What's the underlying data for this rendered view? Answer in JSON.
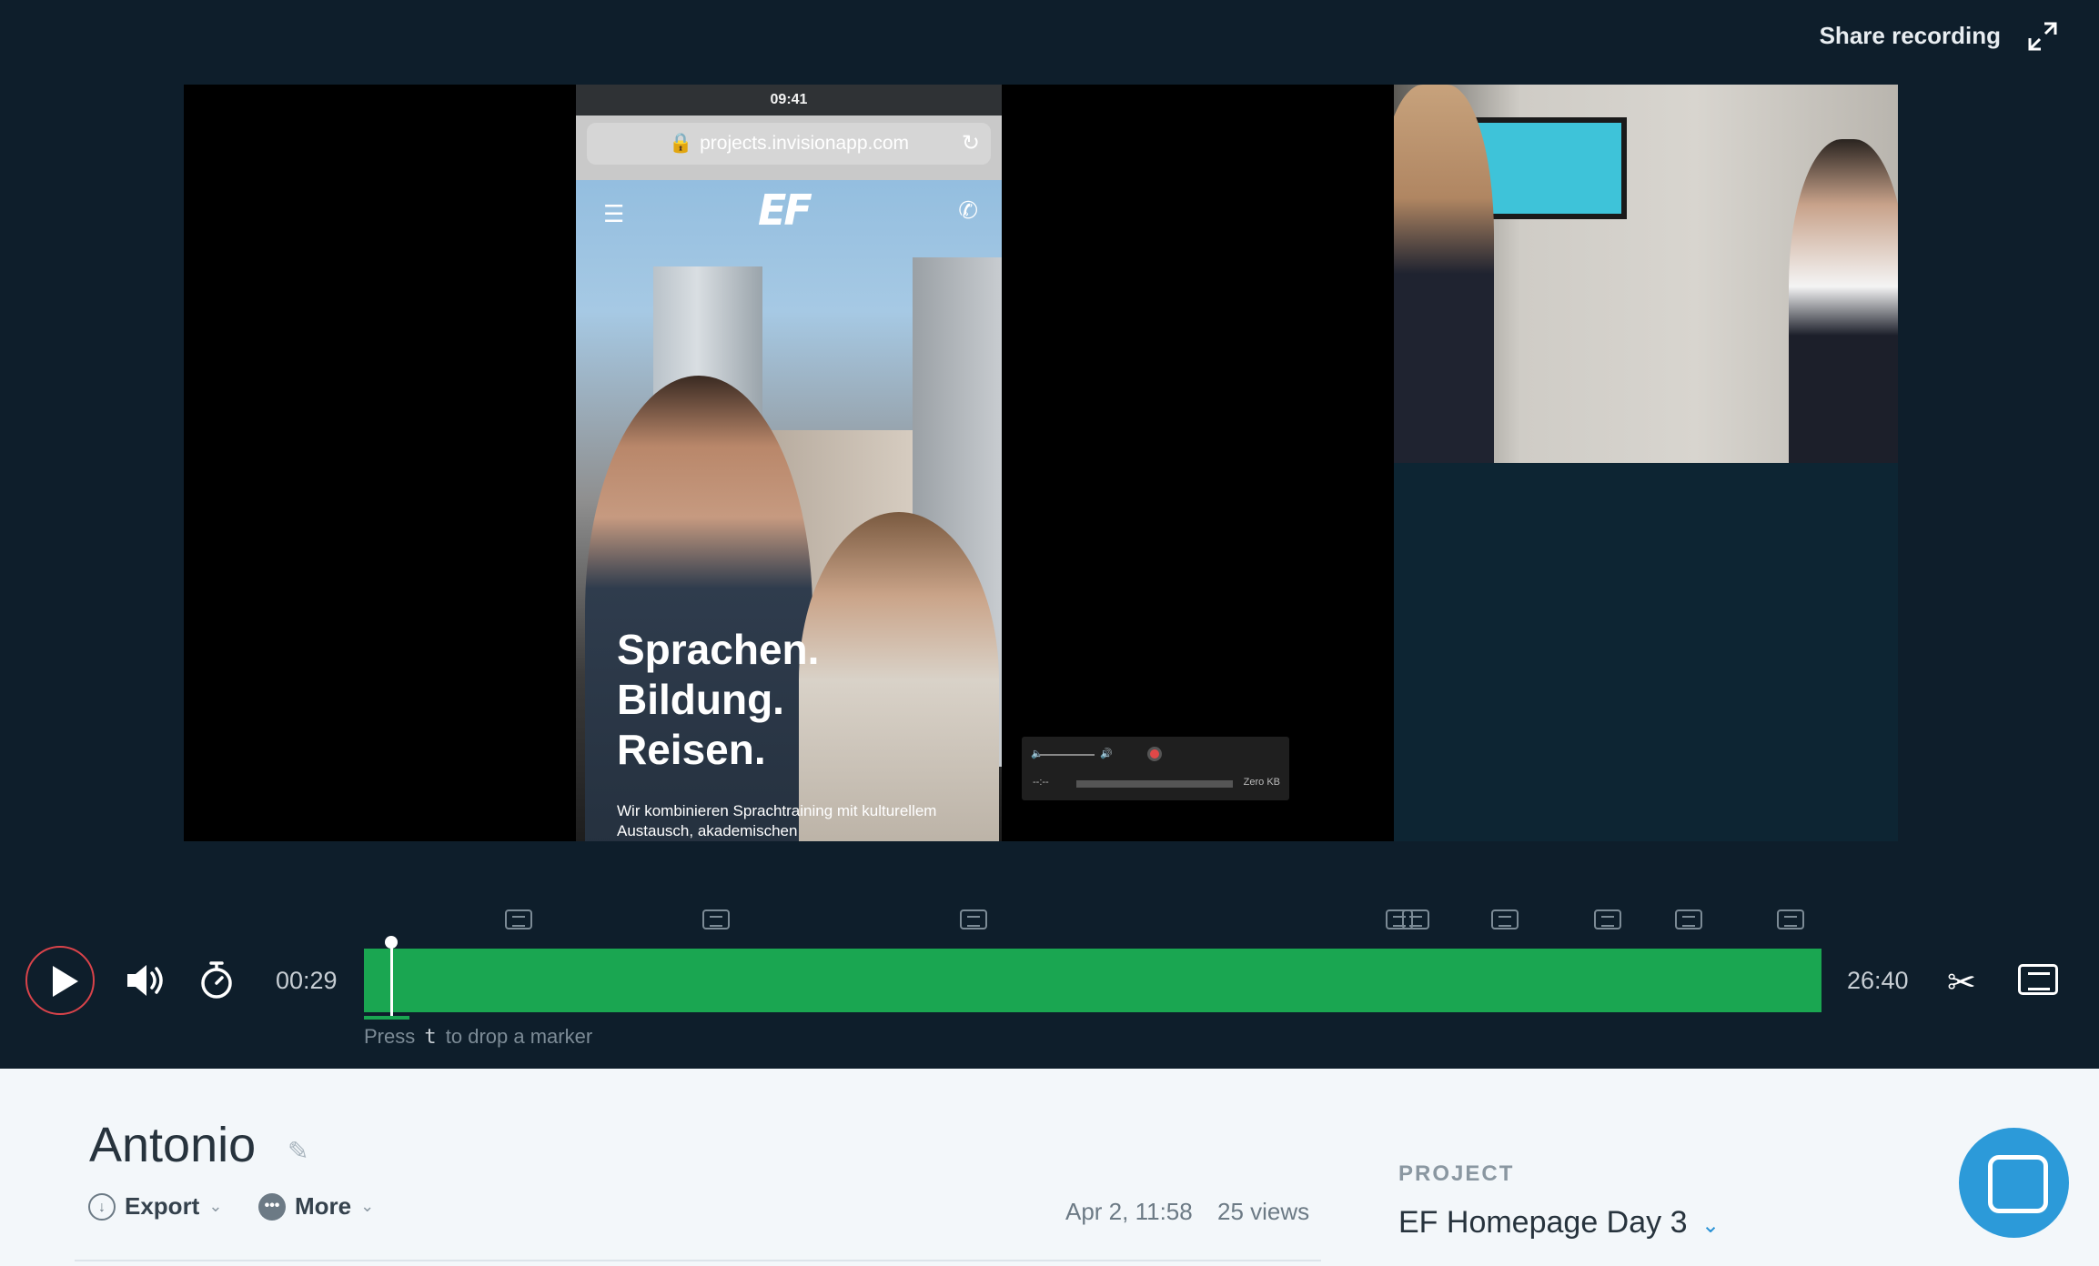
{
  "header": {
    "share_label": "Share recording",
    "expand_icon": "expand-icon"
  },
  "phone": {
    "status_time": "09:41",
    "url": "projects.invisionapp.com",
    "logo": "EF",
    "headline": [
      "Sprachen.",
      "Bildung.",
      "Reisen."
    ],
    "subtext": "Wir kombinieren Sprachtraining mit kulturellem Austausch, akademischen"
  },
  "recorder_widget": {
    "time": "--:--",
    "size": "Zero KB"
  },
  "player": {
    "current_time": "00:29",
    "total_time": "26:40",
    "progress": 0.018,
    "hint_prefix": "Press",
    "hint_key": "t",
    "hint_suffix": "to drop a marker",
    "marker_count": 10
  },
  "session": {
    "title": "Antonio",
    "actions": [
      {
        "label": "Export",
        "icon": "export-icon"
      },
      {
        "label": "More",
        "icon": "more-icon"
      }
    ],
    "date": "Apr 2, 11:58",
    "views": "25 views"
  },
  "project": {
    "label": "PROJECT",
    "name": "EF Homepage Day 3"
  },
  "colors": {
    "background": "#0e1e2b",
    "timeline": "#1f9a4d",
    "play_ring": "#d9434a",
    "chat": "#2c9ad9"
  }
}
